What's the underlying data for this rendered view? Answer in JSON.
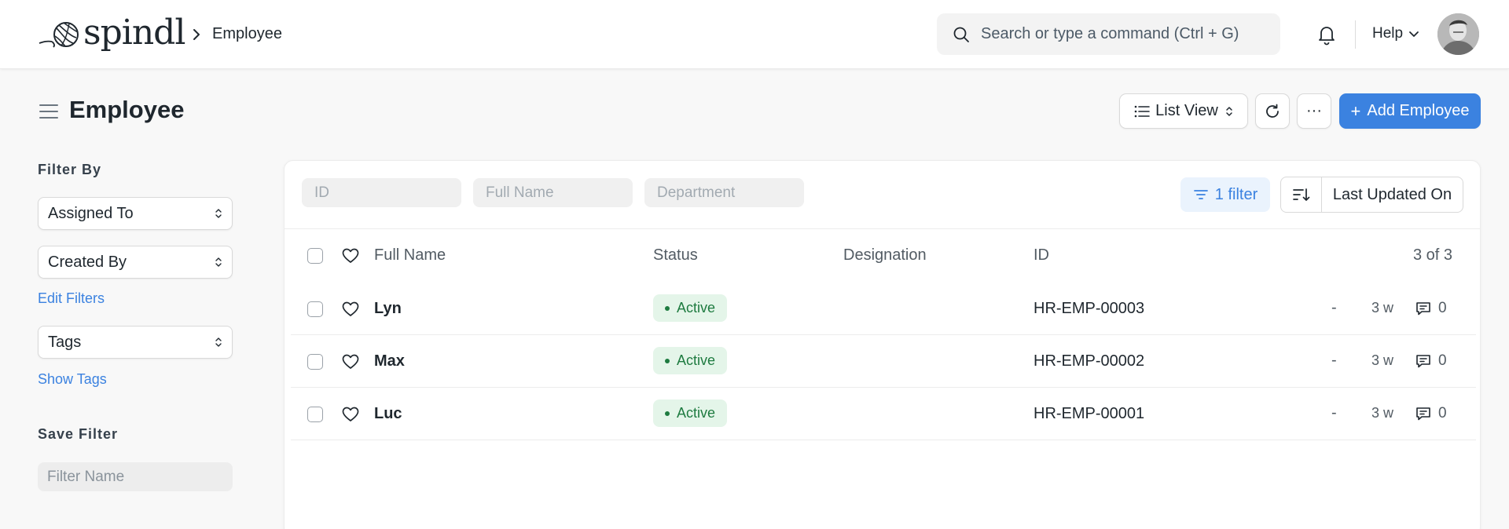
{
  "app": {
    "logo_text": "spindl",
    "breadcrumb": "Employee"
  },
  "navbar": {
    "search_placeholder": "Search or type a command (Ctrl + G)",
    "help_label": "Help"
  },
  "page": {
    "title": "Employee",
    "list_view_label": "List View",
    "more_label": "···",
    "add_label": "Add Employee"
  },
  "sidebar": {
    "filter_by_label": "Filter By",
    "assigned_to": "Assigned To",
    "created_by": "Created By",
    "edit_filters": "Edit Filters",
    "tags": "Tags",
    "show_tags": "Show Tags",
    "save_filter_label": "Save Filter",
    "filter_name_placeholder": "Filter Name"
  },
  "list": {
    "filters": {
      "id_placeholder": "ID",
      "name_placeholder": "Full Name",
      "department_placeholder": "Department"
    },
    "filter_button": "1 filter",
    "sort_field": "Last Updated On",
    "columns": {
      "full_name": "Full Name",
      "status": "Status",
      "designation": "Designation",
      "id": "ID",
      "count": "3 of 3"
    },
    "rows": [
      {
        "name": "Lyn",
        "status": "Active",
        "id": "HR-EMP-00003",
        "dash": "-",
        "age": "3 w",
        "comments": "0"
      },
      {
        "name": "Max",
        "status": "Active",
        "id": "HR-EMP-00002",
        "dash": "-",
        "age": "3 w",
        "comments": "0"
      },
      {
        "name": "Luc",
        "status": "Active",
        "id": "HR-EMP-00001",
        "dash": "-",
        "age": "3 w",
        "comments": "0"
      }
    ]
  },
  "colors": {
    "accent": "#3b82e0",
    "active_bg": "#e4f5e9",
    "active_text": "#1e7b40"
  },
  "icons": [
    "yarn-logo-icon",
    "chevron-right-icon",
    "search-icon",
    "bell-icon",
    "chevron-down-icon",
    "hamburger-icon",
    "list-icon",
    "updown-icon",
    "refresh-icon",
    "filter-icon",
    "sort-icon",
    "heart-icon",
    "comment-icon"
  ]
}
